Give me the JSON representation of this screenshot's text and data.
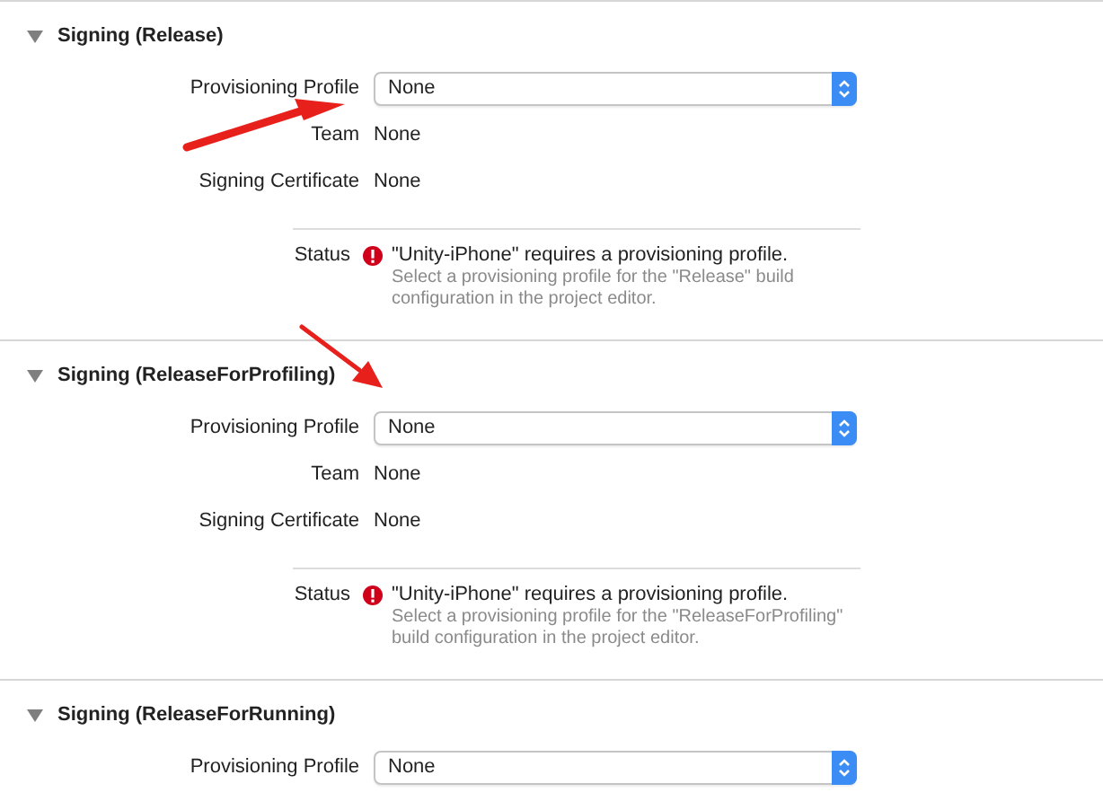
{
  "sections": [
    {
      "title": "Signing (Release)",
      "expanded": true,
      "fields": [
        {
          "label": "Provisioning Profile",
          "kind": "popup",
          "value": "None"
        },
        {
          "label": "Team",
          "kind": "text",
          "value": "None"
        },
        {
          "label": "Signing Certificate",
          "kind": "text",
          "value": "None"
        }
      ],
      "status": {
        "label": "Status",
        "message": "\"Unity-iPhone\" requires a provisioning profile.",
        "detail": "Select a provisioning profile for the \"Release\" build configuration in the project editor."
      }
    },
    {
      "title": "Signing (ReleaseForProfiling)",
      "expanded": true,
      "fields": [
        {
          "label": "Provisioning Profile",
          "kind": "popup",
          "value": "None"
        },
        {
          "label": "Team",
          "kind": "text",
          "value": "None"
        },
        {
          "label": "Signing Certificate",
          "kind": "text",
          "value": "None"
        }
      ],
      "status": {
        "label": "Status",
        "message": "\"Unity-iPhone\" requires a provisioning profile.",
        "detail": "Select a provisioning profile for the \"ReleaseForProfiling\" build configuration in the project editor."
      }
    },
    {
      "title": "Signing (ReleaseForRunning)",
      "expanded": true,
      "fields": [
        {
          "label": "Provisioning Profile",
          "kind": "popup",
          "value": "None"
        }
      ]
    }
  ]
}
